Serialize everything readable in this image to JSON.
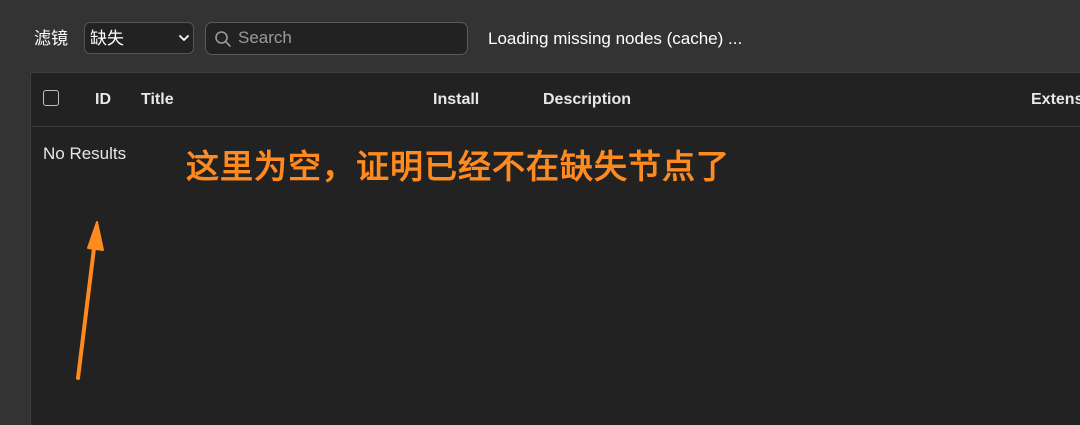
{
  "toolbar": {
    "filter_label": "滤镜",
    "filter_selected": "缺失",
    "search_placeholder": "Search",
    "search_value": "",
    "status_text": "Loading missing nodes (cache) ..."
  },
  "table": {
    "columns": [
      "ID",
      "Title",
      "Install",
      "Description",
      "Extens"
    ],
    "empty_message": "No Results"
  },
  "annotation": {
    "text": "这里为空，证明已经不在缺失节点了",
    "color": "#ff8a1f"
  },
  "colors": {
    "page_background": "#333333",
    "panel_background": "#222222",
    "accent_orange": "#ff8a1f"
  },
  "icons": {
    "search": "search-icon",
    "select_chevron": "chevron-down-icon"
  }
}
